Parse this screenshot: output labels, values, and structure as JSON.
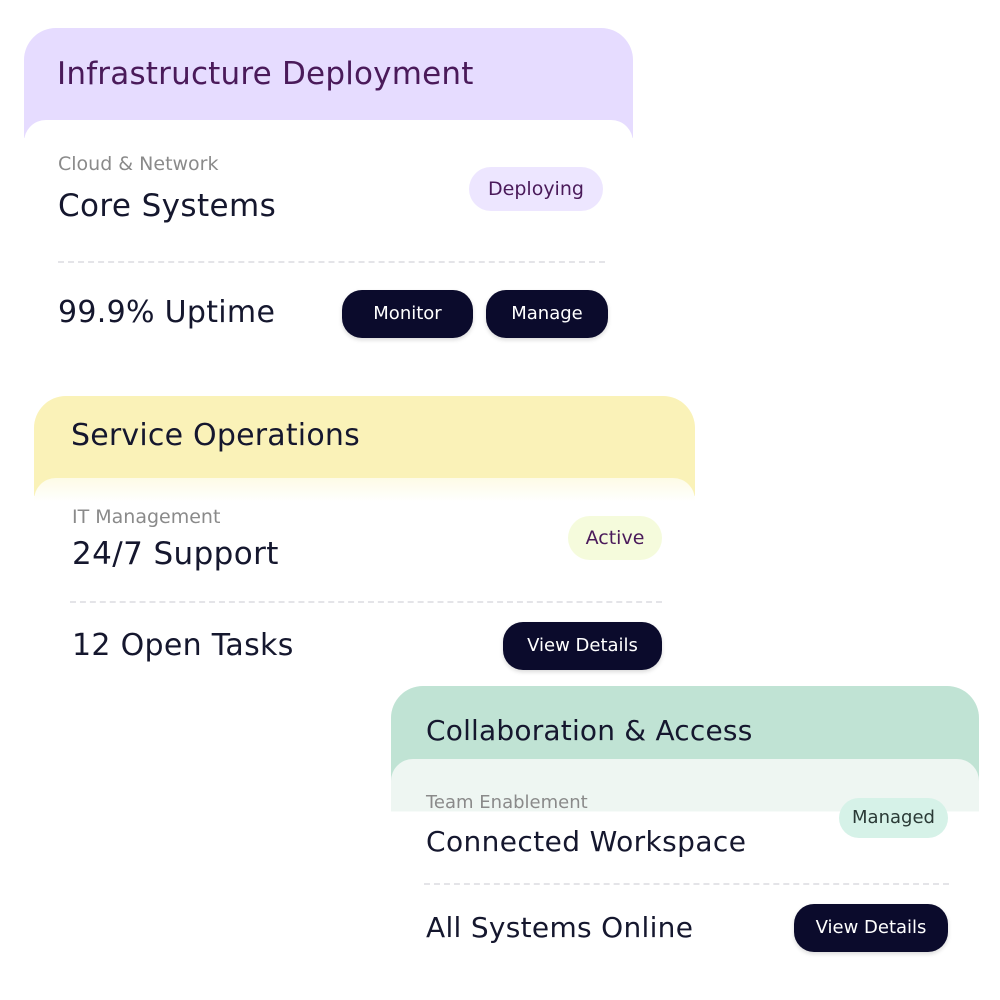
{
  "cards": [
    {
      "title": "Infrastructure Deployment",
      "subtitle": "Cloud & Network",
      "main_title": "Core Systems",
      "status": "Deploying",
      "stat": "99.9% Uptime",
      "buttons": [
        "Monitor",
        "Manage"
      ],
      "colors": {
        "header": "#e6dcff",
        "title_text": "#4a1a5a",
        "badge": "#ede6ff"
      }
    },
    {
      "title": "Service Operations",
      "subtitle": "IT Management",
      "main_title": "24/7 Support",
      "status": "Active",
      "stat": "12 Open Tasks",
      "buttons": [
        "View Details"
      ],
      "colors": {
        "header": "#faf2b8",
        "title_text": "#15172e",
        "badge": "#f5fbdc"
      }
    },
    {
      "title": "Collaboration & Access",
      "subtitle": "Team Enablement",
      "main_title": "Connected Workspace",
      "status": "Managed",
      "stat": "All Systems Online",
      "buttons": [
        "View Details"
      ],
      "colors": {
        "header": "#c0e3d4",
        "title_text": "#15172e",
        "badge": "#d6f2e8"
      }
    }
  ],
  "theme": {
    "button_bg": "#0b0b2c",
    "button_text": "#ffffff",
    "text_primary": "#15172e",
    "text_muted": "#8a8a8a"
  }
}
